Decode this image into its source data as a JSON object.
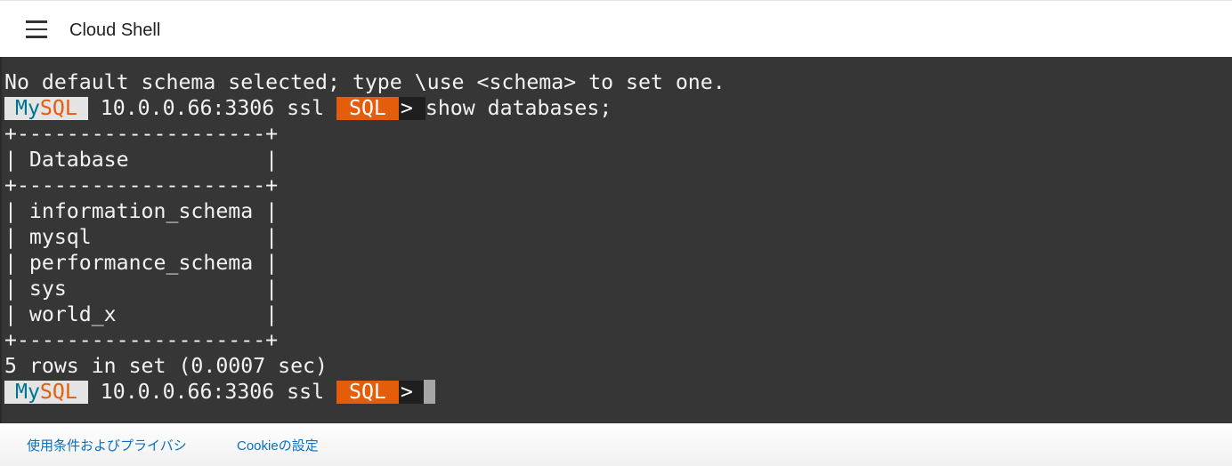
{
  "header": {
    "title": "Cloud Shell",
    "menu_icon": "hamburger-icon"
  },
  "terminal": {
    "intro": "No default schema selected; type \\use <schema> to set one.",
    "prompt": {
      "my": "My",
      "sql": "SQL",
      "host": " 10.0.0.66:3306 ssl ",
      "mode": "SQL",
      "arrow": ">"
    },
    "command": "show databases;",
    "output": [
      "+--------------------+",
      "| Database           |",
      "+--------------------+",
      "| information_schema |",
      "| mysql              |",
      "| performance_schema |",
      "| sys                |",
      "| world_x            |",
      "+--------------------+",
      "5 rows in set (0.0007 sec)"
    ]
  },
  "footer": {
    "terms": "使用条件およびプライバシ",
    "cookies": "Cookieの設定"
  },
  "colors": {
    "mysql_blue": "#00758f",
    "mysql_orange": "#e35d0b",
    "terminal_bg": "#363636",
    "link": "#0b6fc2"
  }
}
